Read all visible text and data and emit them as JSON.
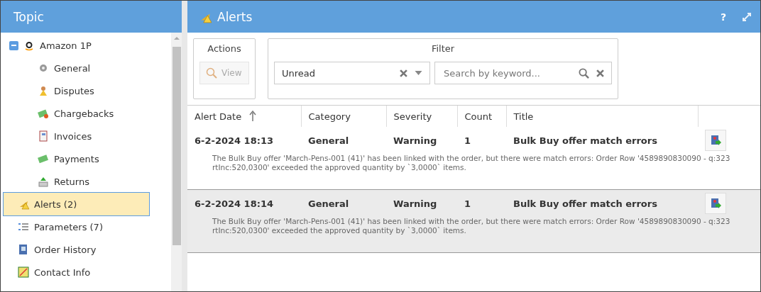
{
  "sidebar": {
    "title": "Topic",
    "tree": [
      {
        "label": "Amazon 1P",
        "expanded": true,
        "selected": false,
        "children": [
          {
            "label": "General",
            "selected": false
          },
          {
            "label": "Disputes",
            "selected": false
          },
          {
            "label": "Chargebacks",
            "selected": false
          },
          {
            "label": "Invoices",
            "selected": false
          },
          {
            "label": "Payments",
            "selected": false
          },
          {
            "label": "Returns",
            "selected": false
          }
        ]
      },
      {
        "label": "Alerts (2)",
        "selected": true
      },
      {
        "label": "Parameters (7)",
        "selected": false
      },
      {
        "label": "Order History",
        "selected": false
      },
      {
        "label": "Contact Info",
        "selected": false
      }
    ]
  },
  "main": {
    "title": "Alerts",
    "help": "?",
    "actions": {
      "title": "Actions",
      "buttons": [
        {
          "label": "View",
          "disabled": true
        }
      ]
    },
    "filter": {
      "title": "Filter",
      "status_value": "Unread",
      "search": {
        "placeholder": "Search by keyword..."
      }
    },
    "table": {
      "columns": [
        {
          "label": "Alert Date",
          "sorted": true
        },
        {
          "label": "Category",
          "sorted": false
        },
        {
          "label": "Severity",
          "sorted": false
        },
        {
          "label": "Count",
          "sorted": false
        },
        {
          "label": "Title",
          "sorted": false
        }
      ],
      "rows": [
        {
          "date": "6-2-2024 18:13",
          "category": "General",
          "severity": "Warning",
          "count": "1",
          "title": "Bulk Buy offer match errors",
          "message": "The Bulk Buy offer 'March-Pens-001 (41)' has been linked with the order, but there were match errors: Order Row '4589890830090 - q:323 rtInc:520,0300' exceeded the approved quantity by `3,0000` items.",
          "selected": false
        },
        {
          "date": "6-2-2024 18:14",
          "category": "General",
          "severity": "Warning",
          "count": "1",
          "title": "Bulk Buy offer match errors",
          "message": "The Bulk Buy offer 'March-Pens-001 (41)' has been linked with the order, but there were match errors: Order Row '4589890830090 - q:323 rtInc:520,0300' exceeded the approved quantity by `3,0000` items.",
          "selected": true
        }
      ]
    }
  }
}
